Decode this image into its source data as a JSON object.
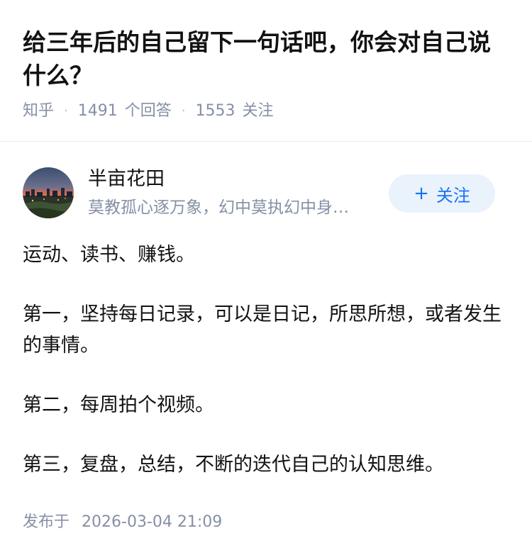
{
  "question": {
    "title": "给三年后的自己留下一句话吧，你会对自己说什么？",
    "source": "知乎",
    "answer_count": "1491",
    "answer_label": "个回答",
    "follower_count": "1553",
    "follower_label": "关注"
  },
  "answer": {
    "author": {
      "name": "半亩花田",
      "bio": "莫教孤心逐万象，幻中莫执幻中身…",
      "avatar_icon": "sunset-landscape-avatar"
    },
    "follow_button": {
      "icon": "plus-icon",
      "plus": "+",
      "label": "关注"
    },
    "paragraphs": [
      "运动、读书、赚钱。",
      "第一，坚持每日记录，可以是日记，所思所想，或者发生的事情。",
      "第二，每周拍个视频。",
      "第三，复盘，总结，不断的迭代自己的认知思维。"
    ],
    "published_label": "发布于",
    "published_time": "2026-03-04 21:09"
  },
  "colors": {
    "text": "#121212",
    "meta": "#8590a6",
    "accent": "#1772f6",
    "follow_bg": "#eaf2fc"
  }
}
